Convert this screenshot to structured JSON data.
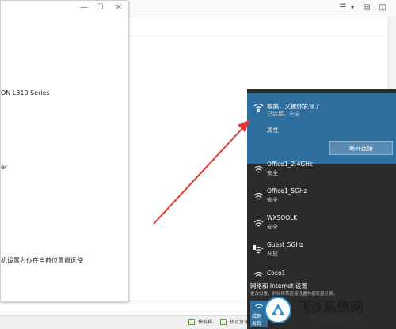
{
  "dialog": {
    "controls": {
      "minimize": "—",
      "maximize": "☐",
      "close": "✕"
    },
    "printer_name": "ON L310 Series",
    "fragment_text": "er",
    "default_printer_note": "机设置为你在当前位置最近使"
  },
  "network_flyout": {
    "connected": {
      "name": "糗鹅，又被你发现了",
      "status": "已连接，安全",
      "properties_label": "属性",
      "disconnect_label": "断开连接"
    },
    "networks": [
      {
        "name": "Office1_2.4GHz",
        "status": "安全"
      },
      {
        "name": "Office1_5GHz",
        "status": "安全"
      },
      {
        "name": "WXSOOLK",
        "status": "安全"
      },
      {
        "name": "Guest_5GHz",
        "status": "开放"
      },
      {
        "name": "Coco1",
        "status": ""
      }
    ],
    "settings_label": "网络和 Internet 设置",
    "settings_sub": "更改设置，例如将某连接设置为按流量计费。",
    "quick_tiles": [
      {
        "label": "成鹅"
      },
      {
        "label": "发现"
      }
    ]
  },
  "taskbar": {
    "items": [
      {
        "label": "快剪辑"
      },
      {
        "label": "热点资讯"
      }
    ]
  },
  "watermark": {
    "title": "飞沙系统网",
    "url": "www.fs0745.com"
  },
  "colors": {
    "flyout_bg": "#2b2b2b",
    "connected_bg": "#2f6f9f",
    "accent_red": "#e53935"
  }
}
